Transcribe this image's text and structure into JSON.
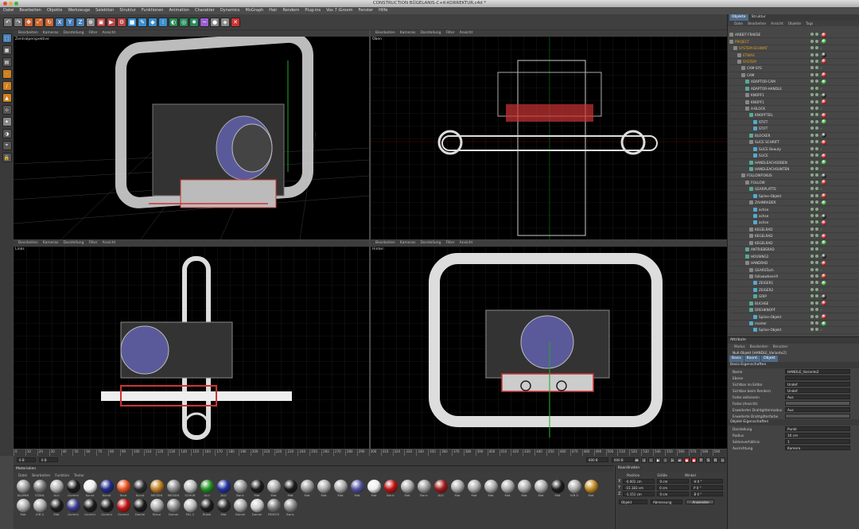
{
  "window": {
    "title": "CONSTRUCTION BÜGELANIS-C+K-KORREKTUR.c4d *"
  },
  "menu": [
    "Datei",
    "Bearbeiten",
    "Objekte",
    "Werkzeuge",
    "Selektion",
    "Struktur",
    "Funktionen",
    "Animation",
    "Charakter",
    "Dynamics",
    "MoGraph",
    "Hair",
    "Rendern",
    "Plug-ins",
    "Vox 7 iGroom",
    "Fenster",
    "Hilfe"
  ],
  "toolbar": [
    "undo-icon",
    "redo-icon",
    "move-tool-icon",
    "scale-tool-icon",
    "rotate-tool-icon",
    "x-axis-icon",
    "y-axis-icon",
    "z-axis-icon",
    "coord-system-icon",
    "render-view-icon",
    "render-picture-icon",
    "render-settings-icon",
    "cube-icon",
    "pen-icon",
    "subdivision-icon",
    "array-icon",
    "environment-icon",
    "camera-icon",
    "light-icon",
    "deformer-icon",
    "scene-icon",
    "tag-icon",
    "python-icon"
  ],
  "viewports": {
    "menu": [
      "Bearbeiten",
      "Kameras",
      "Darstellung",
      "Filter",
      "Ansicht"
    ],
    "labels": {
      "perspective": "Zentralperspektive",
      "top": "Oben",
      "left": "Links",
      "front": "Hinten"
    },
    "status": ""
  },
  "timeline": {
    "ticks": [
      "0",
      "10",
      "20",
      "30",
      "40",
      "50",
      "60",
      "70",
      "80",
      "90",
      "100",
      "110",
      "120",
      "130",
      "140",
      "150",
      "160",
      "170",
      "180",
      "190",
      "200",
      "210",
      "220",
      "230",
      "240",
      "250",
      "260",
      "270",
      "280",
      "290",
      "300",
      "310",
      "320",
      "330",
      "340",
      "350",
      "360",
      "370",
      "380",
      "390",
      "400",
      "410",
      "420",
      "430",
      "440",
      "450",
      "460",
      "470",
      "480",
      "490",
      "500",
      "510",
      "520",
      "530",
      "540",
      "550",
      "560",
      "570",
      "580",
      "590"
    ],
    "start": "0 B",
    "current": "0 B",
    "end": "600 B",
    "fps": "600 B"
  },
  "materials": {
    "title": "Materialien",
    "menu": [
      "Datei",
      "Bearbeiten",
      "Funktion",
      "Textur"
    ],
    "row1": [
      {
        "name": "ALUMIN",
        "color": "#9a9a9a"
      },
      {
        "name": "STAHL",
        "color": "#777777"
      },
      {
        "name": "ALU",
        "color": "#b0b0b0"
      },
      {
        "name": "Gummi",
        "color": "#1a1a1a"
      },
      {
        "name": "Kunst",
        "color": "#eeeeee"
      },
      {
        "name": "Kunst",
        "color": "#1f2a8a"
      },
      {
        "name": "Textr",
        "color": "#e85020"
      },
      {
        "name": "Kunst",
        "color": "#2a2a2a"
      },
      {
        "name": "MESSIN",
        "color": "#c08020"
      },
      {
        "name": "MESSIN",
        "color": "#8a8a8a"
      },
      {
        "name": "SCHUR",
        "color": "#bbbbbb"
      },
      {
        "name": "ALU",
        "color": "#209020"
      },
      {
        "name": "ALU",
        "color": "#2030a0"
      },
      {
        "name": "Baric",
        "color": "#999999"
      },
      {
        "name": "Mat",
        "color": "#1a1a1a"
      },
      {
        "name": "Mat",
        "color": "#aaaaaa"
      },
      {
        "name": "Mat",
        "color": "#1a1a1a"
      },
      {
        "name": "Mat",
        "color": "#999999"
      },
      {
        "name": "Mat",
        "color": "#aaaaaa"
      },
      {
        "name": "Mat",
        "color": "#aaaaaa"
      },
      {
        "name": "Mat",
        "color": "#5050a0"
      },
      {
        "name": "Mat",
        "color": "#eeeeee"
      },
      {
        "name": "Baric",
        "color": "#c01010"
      },
      {
        "name": "Mat",
        "color": "#aaaaaa"
      },
      {
        "name": "Baric",
        "color": "#999999"
      },
      {
        "name": "ALU",
        "color": "#a01818"
      },
      {
        "name": "Mat",
        "color": "#aaaaaa"
      },
      {
        "name": "Mat",
        "color": "#aaaaaa"
      },
      {
        "name": "Mat",
        "color": "#aaaaaa"
      },
      {
        "name": "Mat",
        "color": "#aaaaaa"
      },
      {
        "name": "Mat",
        "color": "#aaaaaa"
      },
      {
        "name": "Mat",
        "color": "#aaaaaa"
      },
      {
        "name": "Mat",
        "color": "#1a1a1a"
      },
      {
        "name": "LYB G",
        "color": "#aaaaaa"
      },
      {
        "name": "Mat",
        "color": "#c08a20"
      }
    ],
    "row2": [
      {
        "name": "Mat",
        "color": "#aaaaaa"
      },
      {
        "name": "LYB G",
        "color": "#aaaaaa"
      },
      {
        "name": "Mat",
        "color": "#1a1a1a"
      },
      {
        "name": "Gummi",
        "color": "#3a3a8a"
      },
      {
        "name": "Gummi",
        "color": "#1a1a1a"
      },
      {
        "name": "Gummi",
        "color": "#1a1a1a"
      },
      {
        "name": "Gummi",
        "color": "#c01010"
      },
      {
        "name": "Damel",
        "color": "#1a1a1a"
      },
      {
        "name": "Resul",
        "color": "#aaaaaa"
      },
      {
        "name": "Damel",
        "color": "#888888"
      },
      {
        "name": "PAL 2",
        "color": "#bbbbbb"
      },
      {
        "name": "Rubel",
        "color": "#1a1a1a"
      },
      {
        "name": "Mat",
        "color": "#2a2a2a"
      },
      {
        "name": "Damel",
        "color": "#aaaaaa"
      },
      {
        "name": "Damel",
        "color": "#cccccc"
      },
      {
        "name": "FENSTE",
        "color": "#777777"
      },
      {
        "name": "Baric",
        "color": "#888888"
      }
    ]
  },
  "coordinates": {
    "title": "Koordinaten",
    "headers": [
      "Position",
      "Größe",
      "Winkel"
    ],
    "rows": [
      {
        "axis": "X",
        "pos": "-0.001 cm",
        "size": "0 cm",
        "ang": "H 0 °"
      },
      {
        "axis": "Y",
        "pos": "-15.183 cm",
        "size": "0 cm",
        "ang": "P 0 °"
      },
      {
        "axis": "Z",
        "pos": "-1.151 cm",
        "size": "0 cm",
        "ang": "B 0 °"
      }
    ],
    "mode": "Objekt",
    "size_mode": "Abmessung",
    "apply": "Anwenden"
  },
  "objects": {
    "tabs": [
      "Objekte",
      "Struktur"
    ],
    "menu": [
      "Datei",
      "Bearbeiten",
      "Ansicht",
      "Objekte",
      "Tags"
    ],
    "items": [
      {
        "name": "ARBEIT-FRAESE",
        "indent": 0,
        "color": "#dddddd",
        "icon": "#888"
      },
      {
        "name": "PROJECT",
        "indent": 0,
        "color": "#e0a020",
        "icon": "#888"
      },
      {
        "name": "SYSTEM-SCHWAT",
        "indent": 1,
        "color": "#e0a020",
        "icon": "#888"
      },
      {
        "name": "ETWAS",
        "indent": 2,
        "color": "#e0a020",
        "icon": "#888"
      },
      {
        "name": "SYSTEM",
        "indent": 2,
        "color": "#e0a020",
        "icon": "#888"
      },
      {
        "name": "CAM-SYS",
        "indent": 3,
        "color": "#dddddd",
        "icon": "#888"
      },
      {
        "name": "CAM",
        "indent": 3,
        "color": "#dddddd",
        "icon": "#888"
      },
      {
        "name": "ADAPTOR-CAM",
        "indent": 4,
        "color": "#dddddd",
        "icon": "#5a9"
      },
      {
        "name": "ADAPTOR-HANDLE",
        "indent": 4,
        "color": "#dddddd",
        "icon": "#5a9"
      },
      {
        "name": "KNOPF1",
        "indent": 4,
        "color": "#dddddd",
        "icon": "#888"
      },
      {
        "name": "KNOPF1",
        "indent": 4,
        "color": "#dddddd",
        "icon": "#888"
      },
      {
        "name": "A-BLOCK",
        "indent": 4,
        "color": "#dddddd",
        "icon": "#888"
      },
      {
        "name": "KNOPFTEIL",
        "indent": 5,
        "color": "#dddddd",
        "icon": "#5a9"
      },
      {
        "name": "STIFT",
        "indent": 6,
        "color": "#dddddd",
        "icon": "#5ac"
      },
      {
        "name": "STIFT",
        "indent": 6,
        "color": "#dddddd",
        "icon": "#5ac"
      },
      {
        "name": "BLOCKER",
        "indent": 5,
        "color": "#dddddd",
        "icon": "#5a9"
      },
      {
        "name": "SLICE SCHRIFT",
        "indent": 5,
        "color": "#dddddd",
        "icon": "#888"
      },
      {
        "name": "SLICE Beauty",
        "indent": 6,
        "color": "#dddddd",
        "icon": "#5ac"
      },
      {
        "name": "SLICE",
        "indent": 6,
        "color": "#dddddd",
        "icon": "#5ac"
      },
      {
        "name": "HANDLEACHSOBEN",
        "indent": 5,
        "color": "#dddddd",
        "icon": "#5a9"
      },
      {
        "name": "HANDLEACHSUNTEN",
        "indent": 5,
        "color": "#dddddd",
        "icon": "#5a9"
      },
      {
        "name": "FOLLOWFOKUS",
        "indent": 3,
        "color": "#dddddd",
        "icon": "#888"
      },
      {
        "name": "FOLLOW",
        "indent": 4,
        "color": "#dddddd",
        "icon": "#888"
      },
      {
        "name": "GEARPLATTE",
        "indent": 5,
        "color": "#dddddd",
        "icon": "#5a9"
      },
      {
        "name": "Spline-Objekt",
        "indent": 6,
        "color": "#dddddd",
        "icon": "#5ac"
      },
      {
        "name": "ZAHNRADER",
        "indent": 5,
        "color": "#dddddd",
        "icon": "#888"
      },
      {
        "name": "achse",
        "indent": 6,
        "color": "#dddddd",
        "icon": "#5ac"
      },
      {
        "name": "achse",
        "indent": 6,
        "color": "#dddddd",
        "icon": "#5ac"
      },
      {
        "name": "achse",
        "indent": 6,
        "color": "#dddddd",
        "icon": "#5ac"
      },
      {
        "name": "KEGELRAD",
        "indent": 5,
        "color": "#dddddd",
        "icon": "#888"
      },
      {
        "name": "KEGELRAD",
        "indent": 5,
        "color": "#dddddd",
        "icon": "#888"
      },
      {
        "name": "KEGELRAD",
        "indent": 5,
        "color": "#dddddd",
        "icon": "#888"
      },
      {
        "name": "ANTRIEBSRAD",
        "indent": 4,
        "color": "#dddddd",
        "icon": "#5a9"
      },
      {
        "name": "HOUSING2",
        "indent": 4,
        "color": "#dddddd",
        "icon": "#5a9"
      },
      {
        "name": "HANDRAD",
        "indent": 4,
        "color": "#dddddd",
        "icon": "#888"
      },
      {
        "name": "GEARSTach",
        "indent": 5,
        "color": "#dddddd",
        "icon": "#888"
      },
      {
        "name": "followwheel-R",
        "indent": 5,
        "color": "#dddddd",
        "icon": "#888"
      },
      {
        "name": "ZEIGER1",
        "indent": 6,
        "color": "#dddddd",
        "icon": "#5ac"
      },
      {
        "name": "ZEIGER2",
        "indent": 6,
        "color": "#dddddd",
        "icon": "#5ac"
      },
      {
        "name": "GRIP",
        "indent": 6,
        "color": "#dddddd",
        "icon": "#5a9"
      },
      {
        "name": "BUCHSE",
        "indent": 5,
        "color": "#dddddd",
        "icon": "#5a9"
      },
      {
        "name": "DREHKNOPF",
        "indent": 5,
        "color": "#dddddd",
        "icon": "#5a9"
      },
      {
        "name": "Spline-Objekt",
        "indent": 6,
        "color": "#dddddd",
        "icon": "#5ac"
      },
      {
        "name": "marker",
        "indent": 5,
        "color": "#dddddd",
        "icon": "#5ac"
      },
      {
        "name": "Spline-Objekt",
        "indent": 6,
        "color": "#dddddd",
        "icon": "#5ac"
      }
    ]
  },
  "attributes": {
    "title": "Attribute",
    "menu": [
      "Modus",
      "Bearbeiten",
      "Benutzer"
    ],
    "object_title": "Null-Objekt [HANDLE_Variante2]",
    "tabs": [
      "Basis",
      "Koord.",
      "Objekt"
    ],
    "section1": "Basis-Eigenschaften",
    "props1": [
      {
        "k": "Name",
        "v": "HANDLE_Variante2"
      },
      {
        "k": "Ebene",
        "v": ""
      },
      {
        "k": "Sichtbar im Editor",
        "v": "Undef."
      },
      {
        "k": "Sichtbar beim Rendern",
        "v": "Undef."
      },
      {
        "k": "Farbe aktivieren",
        "v": "Aus"
      },
      {
        "k": "Farbe (Ansicht)",
        "v": ""
      },
      {
        "k": "Erweiterter Drahtgittermodus",
        "v": "Aus"
      },
      {
        "k": "Erweiterte Drahtgitterfarbe",
        "v": ""
      }
    ],
    "section2": "Objekt-Eigenschaften",
    "props2": [
      {
        "k": "Darstellung",
        "v": "Punkt"
      },
      {
        "k": "Radius",
        "v": "10 cm"
      },
      {
        "k": "Seitenverhältnis",
        "v": "1"
      },
      {
        "k": "Ausrichtung",
        "v": "Kamera"
      }
    ]
  }
}
